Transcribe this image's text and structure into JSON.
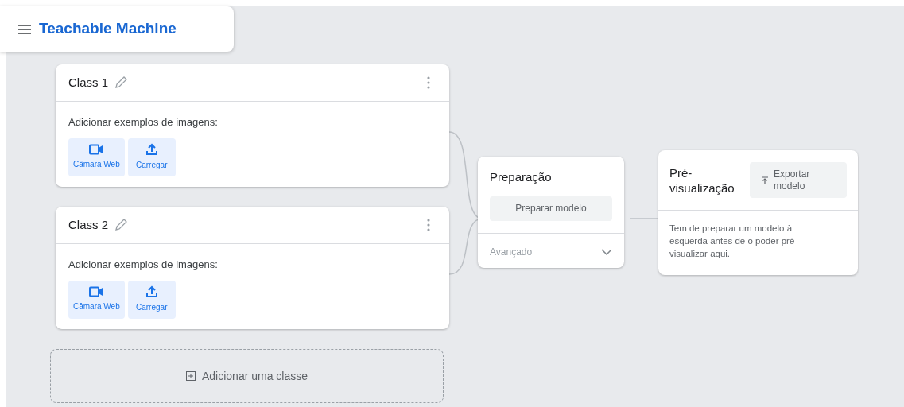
{
  "header": {
    "title": "Teachable Machine"
  },
  "classes": [
    {
      "name": "Class 1",
      "prompt": "Adicionar exemplos de imagens:",
      "sources": [
        {
          "kind": "webcam",
          "label": "Câmara Web"
        },
        {
          "kind": "upload",
          "label": "Carregar"
        }
      ]
    },
    {
      "name": "Class 2",
      "prompt": "Adicionar exemplos de imagens:",
      "sources": [
        {
          "kind": "webcam",
          "label": "Câmara Web"
        },
        {
          "kind": "upload",
          "label": "Carregar"
        }
      ]
    }
  ],
  "add_class": {
    "label": "Adicionar uma classe"
  },
  "training": {
    "title": "Preparação",
    "button": "Preparar modelo",
    "advanced": {
      "label": "Avançado",
      "expanded": false
    }
  },
  "preview": {
    "title": "Pré-visualização",
    "export_button": "Exportar modelo",
    "message": "Tem de preparar um modelo à esquerda antes de o poder pré-visualizar aqui."
  }
}
